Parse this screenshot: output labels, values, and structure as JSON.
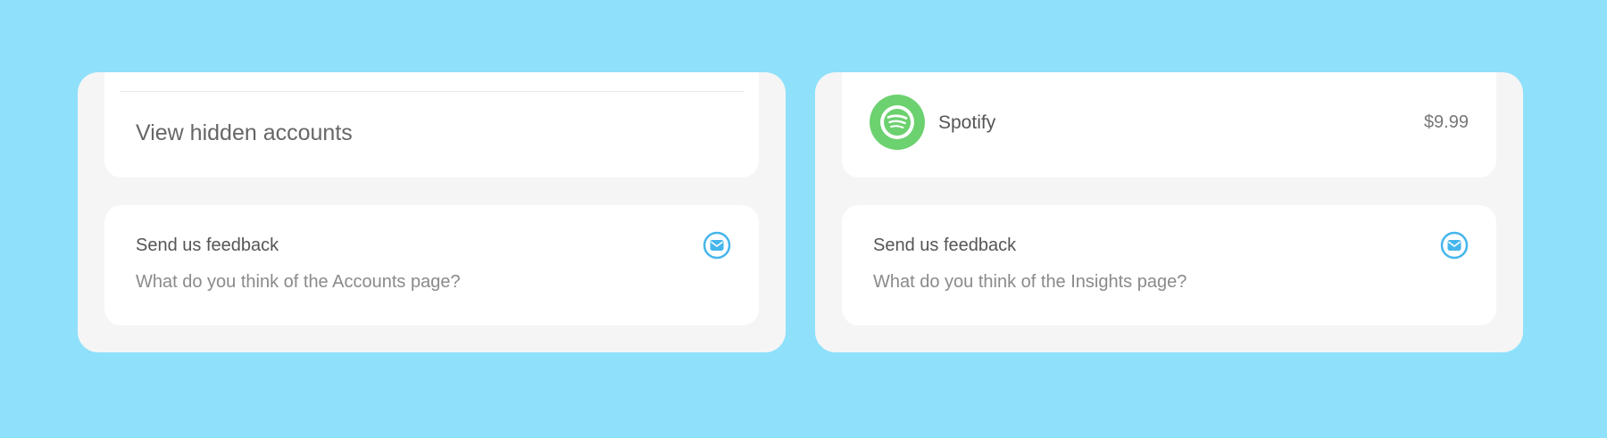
{
  "colors": {
    "background": "#8fe0fb",
    "panel": "#f5f5f5",
    "card": "#ffffff",
    "accent_blue": "#45b6ec",
    "spotify_green": "#6cd16f"
  },
  "accounts_panel": {
    "hidden_accounts_label": "View hidden accounts",
    "feedback": {
      "title": "Send us feedback",
      "subtitle": "What do you think of the Accounts page?",
      "icon": "mail-icon"
    }
  },
  "insights_panel": {
    "subscription": {
      "name": "Spotify",
      "price": "$9.99",
      "icon": "spotify-icon"
    },
    "feedback": {
      "title": "Send us feedback",
      "subtitle": "What do you think of the Insights page?",
      "icon": "mail-icon"
    }
  }
}
